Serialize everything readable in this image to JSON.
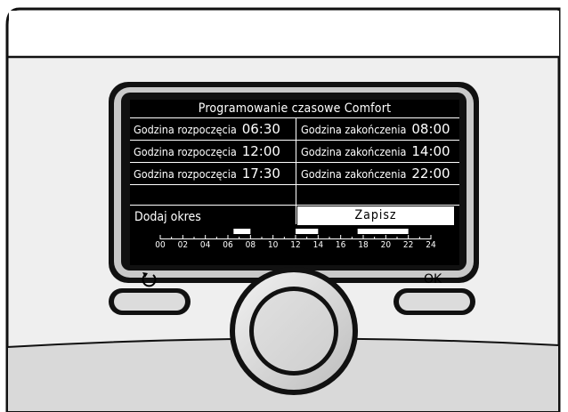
{
  "screen": {
    "title": "Programowanie czasowe Comfort",
    "rows": [
      {
        "start_label": "Godzina rozpoczęcia",
        "start_time": "06:30",
        "end_label": "Godzina zakończenia",
        "end_time": "08:00"
      },
      {
        "start_label": "Godzina rozpoczęcia",
        "start_time": "12:00",
        "end_label": "Godzina zakończenia",
        "end_time": "14:00"
      },
      {
        "start_label": "Godzina rozpoczęcia",
        "start_time": "17:30",
        "end_label": "Godzina zakończenia",
        "end_time": "22:00"
      }
    ],
    "add_label": "Dodaj okres",
    "save_label": "Zapisz",
    "timeline": {
      "ticks": [
        "00",
        "02",
        "04",
        "06",
        "08",
        "10",
        "12",
        "14",
        "16",
        "18",
        "20",
        "22",
        "24"
      ],
      "periods": [
        [
          6.5,
          8.0
        ],
        [
          12.0,
          14.0
        ],
        [
          17.5,
          22.0
        ]
      ]
    }
  },
  "buttons": {
    "back_icon": "undo-arrow-icon",
    "ok_label": "OK",
    "knob_icon": "rotary-knob-icon"
  }
}
